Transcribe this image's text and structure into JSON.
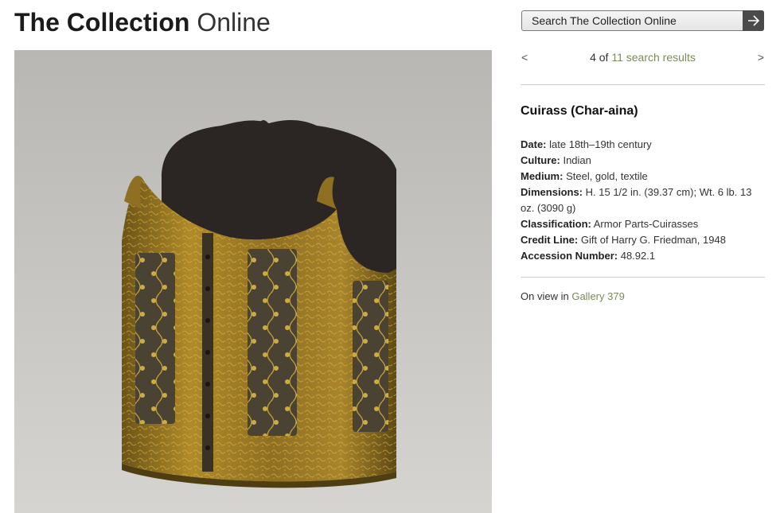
{
  "site": {
    "title_bold": "The Collection",
    "title_light": "Online"
  },
  "search": {
    "placeholder": "Search The Collection Online"
  },
  "pager": {
    "prev": "<",
    "next": ">",
    "current": "4",
    "of": "of",
    "total": "11",
    "suffix": "search results"
  },
  "object": {
    "title": "Cuirass (Char-aina)",
    "details": [
      {
        "label": "Date:",
        "value": "late 18th–19th century"
      },
      {
        "label": "Culture:",
        "value": "Indian"
      },
      {
        "label": "Medium:",
        "value": "Steel, gold, textile"
      },
      {
        "label": "Dimensions:",
        "value": "H. 15 1/2 in. (39.37 cm); Wt. 6 lb. 13 oz. (3090 g)"
      },
      {
        "label": "Classification:",
        "value": "Armor Parts-Cuirasses"
      },
      {
        "label": "Credit Line:",
        "value": "Gift of Harry G. Friedman, 1948"
      },
      {
        "label": "Accession Number:",
        "value": "48.92.1"
      }
    ]
  },
  "on_view": {
    "prefix": "On view in",
    "gallery": "Gallery 379"
  },
  "colors": {
    "link": "#7a8a5a",
    "search_button": "#4a4a4a"
  }
}
